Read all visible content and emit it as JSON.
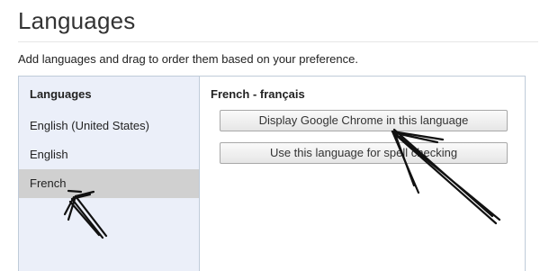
{
  "page": {
    "title": "Languages",
    "description": "Add languages and drag to order them based on your preference."
  },
  "language_list": {
    "header": "Languages",
    "items": [
      {
        "label": "English (United States)",
        "selected": false
      },
      {
        "label": "English",
        "selected": false
      },
      {
        "label": "French",
        "selected": true
      }
    ]
  },
  "detail": {
    "title": "French - français",
    "display_button_label": "Display Google Chrome in this language",
    "spellcheck_button_label": "Use this language for spell checking"
  }
}
